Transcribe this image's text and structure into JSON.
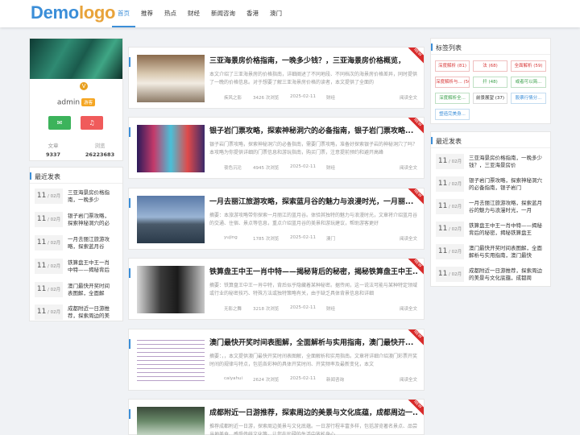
{
  "brand": {
    "logo_a": "Demo",
    "logo_b": "logo"
  },
  "nav": [
    "首页",
    "推荐",
    "热点",
    "财经",
    "新闻咨询",
    "香港",
    "澳门"
  ],
  "profile": {
    "badge": "V",
    "name": "admin",
    "tag": "游客",
    "wechat_icon": "wechat-icon",
    "bell_icon": "bell-icon",
    "stats": [
      {
        "k": "文章",
        "v": "9337"
      },
      {
        "k": "浏览",
        "v": "26223683"
      }
    ]
  },
  "recent_left": {
    "title": "最近发表",
    "items": [
      {
        "day": "11",
        "mon": "02月",
        "text": "三亚海景房价格指南，一晚多少"
      },
      {
        "day": "11",
        "mon": "02月",
        "text": "银子岩门票攻略，探索神秘洞穴的必"
      },
      {
        "day": "11",
        "mon": "02月",
        "text": "一月去丽江旅游攻略，探索蓝月谷"
      },
      {
        "day": "11",
        "mon": "02月",
        "text": "铁算盘王中王一肖中特——揭秘背后"
      },
      {
        "day": "11",
        "mon": "02月",
        "text": "澳门最快开奖时间表图解，全面解"
      },
      {
        "day": "11",
        "mon": "02月",
        "text": "成都附近一日游推荐，探索周边的美"
      }
    ]
  },
  "articles": [
    {
      "title": "三亚海景房价格指南，一晚多少钱？，三亚海景房价格概览，",
      "excerpt": "本文介绍了三亚海景房的价格指南，详细阐述了不同地段、不同档次的海景房价格差异，同时提供了一晚的价格信息。对于想要了解三亚海景房价格的读者，本文提供了全面的",
      "author": "疾风之影",
      "views": "3426 次浏览",
      "date": "2025-02-11",
      "cat": "财经",
      "more": "阅读全文",
      "ribbon": "NEW"
    },
    {
      "title": "银子岩门票攻略，探索神秘洞穴的必备指南，银子岩门票攻略...",
      "excerpt": "银子岩门票攻略，探索神秘洞穴的必备指南，需要门票攻略，准备好探索银子岩的神秘洞穴了吗？本攻略为你提供详细的门票信息和游玩指南，购买门票，注意提前预约和避开高峰",
      "author": "夜色沉沦",
      "views": "4945 次浏览",
      "date": "2025-02-11",
      "cat": "财经",
      "more": "阅读全文",
      "ribbon": "NEW"
    },
    {
      "title": "一月去丽江旅游攻略，探索蓝月谷的魅力与浪漫时光，一月丽...",
      "excerpt": "摘要：本旅游攻略带你探索一月丽江的蓝月谷。体验其独特的魅力与浪漫时光，文章将介绍蓝月谷的交通、住宿、景点等信息，重点介绍蓝月谷的美景和游玩建议，帮助游客更好",
      "author": "yujing",
      "views": "1785 次浏览",
      "date": "2025-02-11",
      "cat": "澳门",
      "more": "阅读全文",
      "ribbon": "NEW"
    },
    {
      "title": "铁算盘王中王一肖中特——揭秘背后的秘密，揭秘铁算盘王中王...",
      "excerpt": "摘要：铁算盘王中王一肖中特，背后似乎隐藏着某种秘密。据传闻，这一说法可能与某种特定领域或行业的秘密技巧、特殊方法或独特策略有关，由于缺乏具体背景信息和详细",
      "author": "无影之舞",
      "views": "3218 次浏览",
      "date": "2025-02-11",
      "cat": "财经",
      "more": "阅读全文",
      "ribbon": "NEW"
    },
    {
      "title": "澳门最快开奖时间表图解，全面解析与实用指南，澳门最快开...",
      "excerpt": "摘要：，，本文提供澳门最快开奖时间表图解，全面解析和实用指南。文章将详细介绍澳门彩票开奖时间的规律与特点，包括各彩种的具体开奖时间、开奖频率及最新变化，本文",
      "author": "caiyahui",
      "views": "2624 次浏览",
      "date": "2025-02-11",
      "cat": "新闻咨询",
      "more": "阅读全文",
      "ribbon": "NEW"
    },
    {
      "title": "成都附近一日游推荐，探索周边的美景与文化底蕴，成都周边一...",
      "excerpt": "推荐成都附近一日游，探索周边美景与文化底蕴。一日游行程丰富多样，包括游览著名景点、品尝当地美食、感受传统文化等，让您在忙碌的生活中放松身心",
      "author": "",
      "views": "",
      "date": "",
      "cat": "",
      "more": "",
      "ribbon": "NEW"
    }
  ],
  "tags": {
    "title": "标签列表",
    "items": [
      {
        "t": "深度解析 (81)",
        "c": "#d83838"
      },
      {
        "t": "法 (68)",
        "c": "#d83838"
      },
      {
        "t": "全面解析 (59)",
        "c": "#d83838"
      },
      {
        "t": "深度解析与... (50)",
        "c": "#d83838"
      },
      {
        "t": "扦 (48)",
        "c": "#3aa04a"
      },
      {
        "t": "或者可以简...",
        "c": "#3aa04a"
      },
      {
        "t": "深度解析全...",
        "c": "#3aa04a"
      },
      {
        "t": "前景展望 (37)",
        "c": "#333333"
      },
      {
        "t": "股票行情分...",
        "c": "#3b8ed8"
      },
      {
        "t": "塑造完美身...",
        "c": "#3b8ed8"
      }
    ]
  },
  "recent_right": {
    "title": "最近发表",
    "items": [
      {
        "day": "11",
        "mon": "02月",
        "text": "三亚海景房价格指南，一晚多少钱？，三亚海景房价"
      },
      {
        "day": "11",
        "mon": "02月",
        "text": "银子岩门票攻略，探索神秘洞穴的必备指南，银子岩门"
      },
      {
        "day": "11",
        "mon": "02月",
        "text": "一月去丽江旅游攻略，探索蓝月谷的魅力与浪漫时光，一月"
      },
      {
        "day": "11",
        "mon": "02月",
        "text": "铁算盘王中王一肖中特——揭秘背后的秘密，揭秘铁算盘王"
      },
      {
        "day": "11",
        "mon": "02月",
        "text": "澳门最快开奖时间表图解，全面解析与实用指南，澳门最快"
      },
      {
        "day": "11",
        "mon": "02月",
        "text": "成都附近一日游推荐，探索周边的美景与文化底蕴，成都周"
      }
    ]
  }
}
